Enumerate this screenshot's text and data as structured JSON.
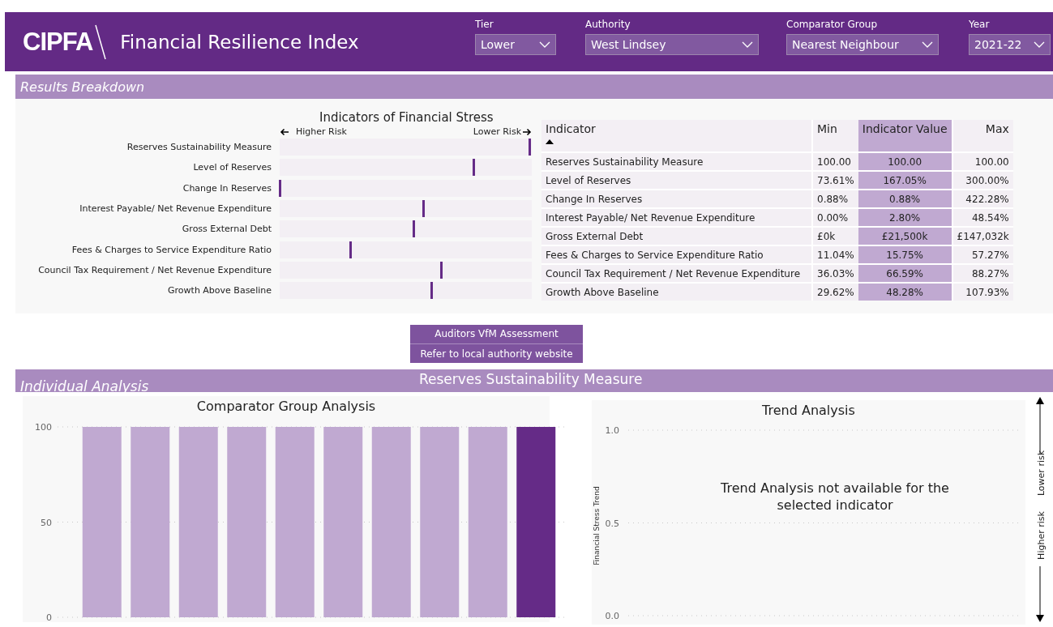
{
  "header": {
    "logo": "CIPFA",
    "title": "Financial Resilience Index"
  },
  "filters": [
    {
      "label": "Tier",
      "value": "Lower"
    },
    {
      "label": "Authority",
      "value": "West Lindsey"
    },
    {
      "label": "Comparator Group",
      "value": "Nearest Neighbour"
    },
    {
      "label": "Year",
      "value": "2021-22"
    }
  ],
  "results": {
    "heading": "Results Breakdown",
    "stress": {
      "title": "Indicators of Financial Stress",
      "higher_label": "Higher Risk",
      "lower_label": "Lower Risk",
      "items": [
        {
          "label": "Reserves Sustainability Measure",
          "level": 0.99
        },
        {
          "label": "Level of Reserves",
          "level": 0.77
        },
        {
          "label": "Change In Reserves",
          "level": 0.0
        },
        {
          "label": "Interest Payable/ Net Revenue Expenditure",
          "level": 0.57
        },
        {
          "label": "Gross External Debt",
          "level": 0.53
        },
        {
          "label": "Fees & Charges to Service Expenditure Ratio",
          "level": 0.28
        },
        {
          "label": "Council Tax Requirement / Net Revenue Expenditure",
          "level": 0.64
        },
        {
          "label": "Growth Above Baseline",
          "level": 0.6
        }
      ]
    },
    "table": {
      "columns": [
        {
          "label": "Indicator",
          "highlighted": false,
          "sorted": true
        },
        {
          "label": "Min",
          "highlighted": false,
          "sorted": false
        },
        {
          "label": "Indicator Value",
          "highlighted": true,
          "sorted": false
        },
        {
          "label": "Max",
          "highlighted": false,
          "sorted": false
        }
      ],
      "rows": [
        [
          "Reserves Sustainability Measure",
          "100.00",
          "100.00",
          "100.00"
        ],
        [
          "Level of Reserves",
          "73.61%",
          "167.05%",
          "300.00%"
        ],
        [
          "Change In Reserves",
          "0.88%",
          "0.88%",
          "422.28%"
        ],
        [
          "Interest Payable/ Net Revenue Expenditure",
          "0.00%",
          "2.80%",
          "48.54%"
        ],
        [
          "Gross External Debt",
          "£0k",
          "£21,500k",
          "£147,032k"
        ],
        [
          "Fees & Charges to Service Expenditure Ratio",
          "11.04%",
          "15.75%",
          "57.27%"
        ],
        [
          "Council Tax Requirement / Net Revenue Expenditure",
          "36.03%",
          "66.59%",
          "88.27%"
        ],
        [
          "Growth Above Baseline",
          "29.62%",
          "48.28%",
          "107.93%"
        ]
      ]
    }
  },
  "vfm": {
    "title": "Auditors VfM Assessment",
    "value": "Refer to local authority website"
  },
  "individual": {
    "heading": "Individual Analysis",
    "indicator": "Reserves Sustainability Measure",
    "comparator_chart": {
      "chart_data": {
        "type": "bar",
        "title": "Comparator Group Analysis",
        "ylim": [
          0,
          100
        ],
        "yticks": [
          0,
          50,
          100
        ],
        "series": [
          {
            "color": "#c0a9d1",
            "values": [
              100,
              100,
              100,
              100,
              100,
              100,
              100,
              100,
              100,
              null
            ]
          },
          {
            "color": "#652b87",
            "values": [
              null,
              null,
              null,
              null,
              null,
              null,
              null,
              null,
              null,
              100
            ]
          }
        ]
      }
    },
    "trend_chart": {
      "title": "Trend Analysis",
      "ylabel": "Financial Stress Trend",
      "tick_labels": [
        "1.0",
        "0.5",
        "0.0"
      ],
      "message": "Trend Analysis not available for the selected indicator"
    },
    "risk_axis": {
      "upper": "Lower risk",
      "lower": "Higher risk"
    }
  }
}
